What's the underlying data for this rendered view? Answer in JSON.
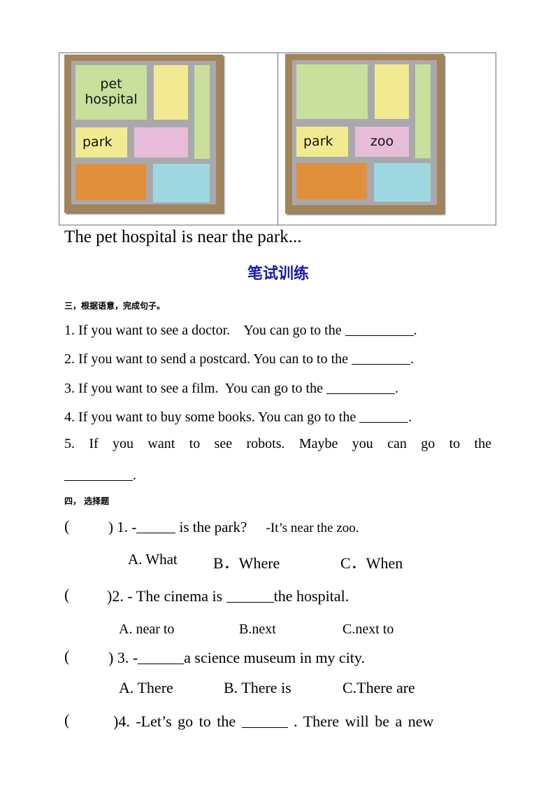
{
  "maps": [
    {
      "blocks": {
        "green_top": "pet hospital",
        "yellow_top": "",
        "green_side": "",
        "yellow_mid": "park",
        "pink_mid": "",
        "orange_bottom": "",
        "blue_bottom": ""
      }
    },
    {
      "blocks": {
        "green_top": "",
        "yellow_top": "",
        "green_side": "",
        "yellow_mid": "park",
        "pink_mid": "zoo",
        "orange_bottom": "",
        "blue_bottom": ""
      }
    }
  ],
  "map_colors": {
    "frame": "#a2845a",
    "road": "#a9a9ad",
    "green": "#c8e09c",
    "yellow": "#f2ea91",
    "pink": "#e8bcd9",
    "orange": "#e28f3c",
    "blue": "#9ed8e0"
  },
  "caption": "The pet hospital  is near the park...",
  "section_title": "笔试训练",
  "section_title_color": "#1a1aa8",
  "part3": {
    "heading": "三，根据语意，完成句子。",
    "questions": [
      {
        "number": "1.",
        "text": "If you want to see a doctor.    You can go to the ",
        "end": "."
      },
      {
        "number": "2.",
        "text": "If you want to send a postcard. You can to to the ",
        "end": "."
      },
      {
        "number": "3.",
        "text": "If you want to see a film.  You can go to the ",
        "end": "."
      },
      {
        "number": "4.",
        "text": "If you want to buy some books. You can go to the ",
        "end": "."
      },
      {
        "number": "5.",
        "text_words": [
          "5.",
          "If",
          "you",
          "want",
          "to",
          "see",
          "robots.",
          "",
          "Maybe",
          "you",
          "can",
          "go",
          "to",
          "the"
        ],
        "end": "."
      }
    ]
  },
  "part4": {
    "heading": "四，  选择题",
    "questions": [
      {
        "paren": "(",
        "close": ") 1. -",
        "after_blank": " is the park?",
        "reply": "-It’s near the zoo.",
        "options": [
          "A. What",
          "B．Where",
          "C．When"
        ]
      },
      {
        "paren": "(",
        "close": ")2. - The cinema is ",
        "after_blank": "the hospital.",
        "options": [
          "A. near to",
          "B.next",
          "C.next to"
        ]
      },
      {
        "paren": "(",
        "close": ") 3. -",
        "after_blank": "a science museum in my city.",
        "options": [
          "A. There",
          "B. There is",
          "C.There are"
        ]
      },
      {
        "paren": "(",
        "close": ")4. -Let’s go to the ",
        "after_blank": " . There will be a new"
      }
    ]
  }
}
